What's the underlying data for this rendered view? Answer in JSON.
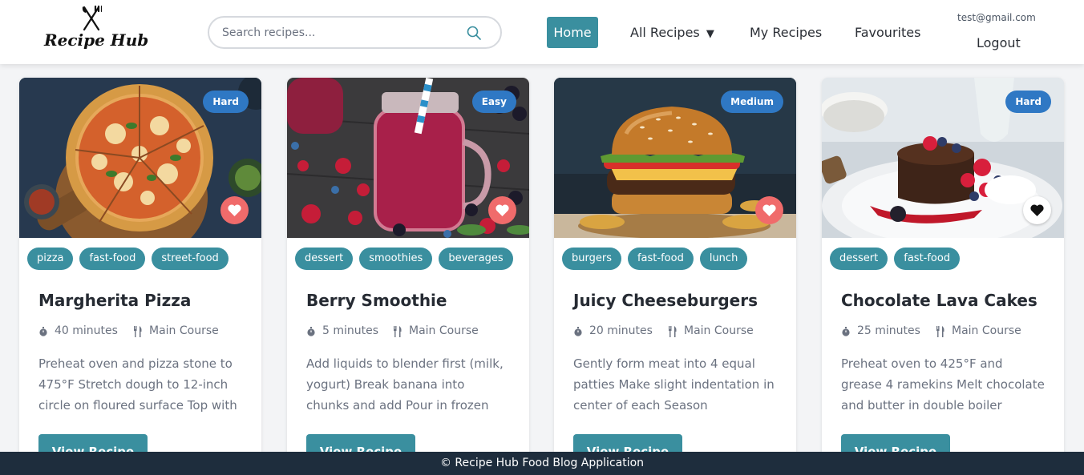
{
  "app": {
    "logo_text": "Recipe Hub",
    "logo_icon": "fork-knife-icon"
  },
  "search": {
    "placeholder": "Search recipes...",
    "value": "",
    "icon": "search-icon"
  },
  "nav": {
    "home": "Home",
    "all_recipes": "All Recipes",
    "all_recipes_caret": "▼",
    "my_recipes": "My Recipes",
    "favourites": "Favourites",
    "user_email": "test@gmail.com",
    "logout": "Logout"
  },
  "colors": {
    "accent": "#3a8f9f",
    "badge": "#2f78c4",
    "favourite": "#f06b6b",
    "footer_bg": "#1e2d3d"
  },
  "recipes": [
    {
      "title": "Margherita Pizza",
      "difficulty": "Hard",
      "tags": [
        "pizza",
        "fast-food",
        "street-food"
      ],
      "time": "40 minutes",
      "course": "Main Course",
      "description": "Preheat oven and pizza stone to 475°F  Stretch dough to 12-inch circle on floured surface  Top with sauce and cheese",
      "favourited": false,
      "button": "View Recipe",
      "image": "pizza"
    },
    {
      "title": "Berry Smoothie",
      "difficulty": "Easy",
      "tags": [
        "dessert",
        "smoothies",
        "beverages"
      ],
      "time": "5 minutes",
      "course": "Main Course",
      "description": "Add liquids to blender first (milk, yogurt)  Break banana into chunks and add  Pour in frozen berries",
      "favourited": false,
      "button": "View Recipe",
      "image": "smoothie"
    },
    {
      "title": "Juicy Cheeseburgers",
      "difficulty": "Medium",
      "tags": [
        "burgers",
        "fast-food",
        "lunch"
      ],
      "time": "20 minutes",
      "course": "Main Course",
      "description": "Gently form meat into 4 equal patties  Make slight indentation in center of each  Season generously",
      "favourited": false,
      "button": "View Recipe",
      "image": "burger"
    },
    {
      "title": "Chocolate Lava Cakes",
      "difficulty": "Hard",
      "tags": [
        "dessert",
        "fast-food"
      ],
      "time": "25 minutes",
      "course": "Main Course",
      "description": "Preheat oven to 425°F and grease 4 ramekins  Melt chocolate and butter in double boiler",
      "favourited": true,
      "button": "View Recipe",
      "image": "lava-cake"
    }
  ],
  "footer": {
    "text": "© Recipe Hub Food Blog Application"
  }
}
